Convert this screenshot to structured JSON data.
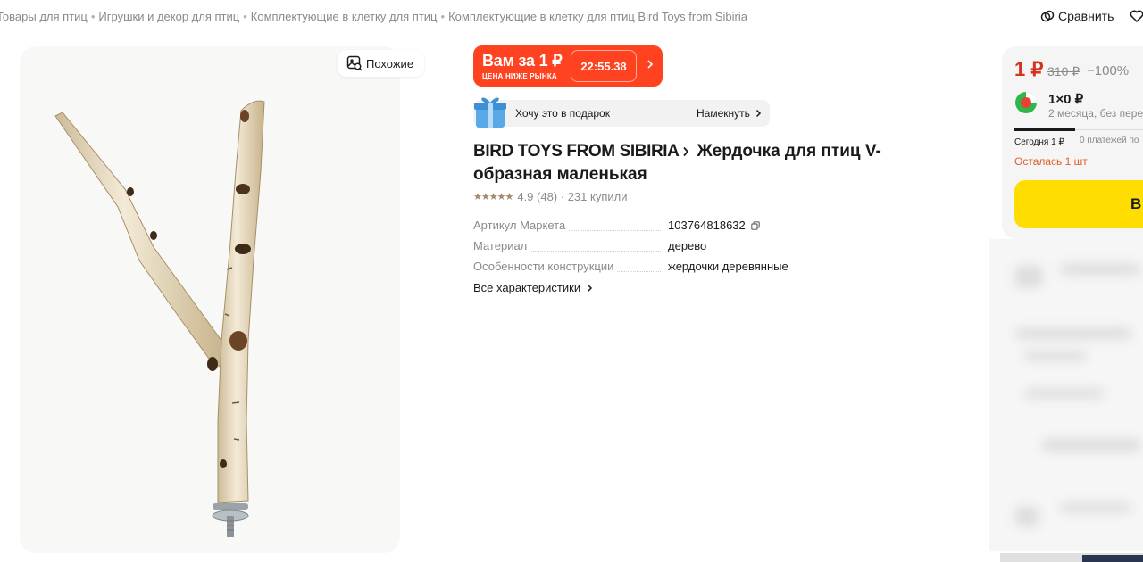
{
  "breadcrumbs": [
    "Товары для птиц",
    "Игрушки и декор для птиц",
    "Комплектующие в клетку для птиц",
    "Комплектующие в клетку для птиц Bird Toys from Sibiria"
  ],
  "breadcrumb_separator": "•",
  "header": {
    "compare_label": "Сравнить",
    "icons": [
      "compare-icon",
      "heart-icon"
    ]
  },
  "gallery": {
    "similar_label": "Похожие",
    "image": "birch-branch-perch-photo"
  },
  "promo": {
    "title": "Вам за 1 ₽",
    "subtitle": "ЦЕНА НИЖЕ РЫНКА",
    "timer": "22:55.38",
    "color": "#ff4321"
  },
  "gift": {
    "text": "Хочу это в подарок",
    "hint_label": "Намекнуть"
  },
  "product": {
    "brand": "BIRD TOYS FROM SIBIRIA",
    "title": "Жердочка для птиц V-образная маленькая",
    "stars": "★★★★★",
    "rating": "4.9",
    "reviews": "(48)",
    "purchases": "· 231 купили"
  },
  "specs": [
    {
      "label": "Артикул Маркета",
      "value": "103764818632"
    },
    {
      "label": "Материал",
      "value": "дерево"
    },
    {
      "label": "Особенности конструкции",
      "value": "жердочки деревянные"
    }
  ],
  "all_specs_label": "Все характеристики",
  "price_card": {
    "price": "1 ₽",
    "old_price": "310 ₽",
    "discount": "−100%",
    "split_price": "1×0 ₽",
    "split_term": "2 месяца, без пере",
    "tab_today": "Сегодня 1 ₽",
    "tab_no_payment": "0 платежей по",
    "stock": "Осталась 1 шт",
    "buy_label": "В",
    "accent_color": "#d5331b",
    "button_color": "#ffdd00"
  }
}
